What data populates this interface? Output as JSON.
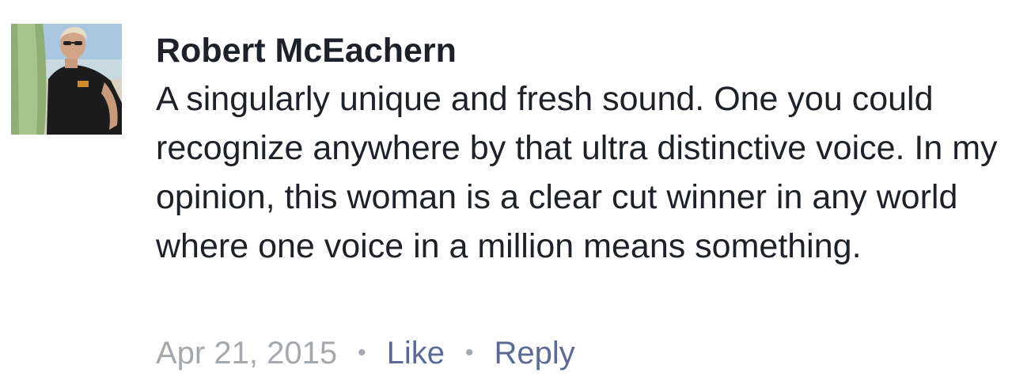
{
  "comment": {
    "author": "Robert McEachern",
    "avatar_icon": "profile-photo",
    "text": "A singularly unique and fresh sound. One you could recognize anywhere by that ultra distinctive voice. In my opinion, this woman is a clear cut winner in any world where one voice in a million means something.",
    "timestamp": "Apr 21, 2015",
    "separator": "•",
    "like_label": "Like",
    "reply_label": "Reply"
  },
  "colors": {
    "text": "#1d2129",
    "meta_gray": "#a4a8af",
    "action_blue": "#5b6b96"
  }
}
